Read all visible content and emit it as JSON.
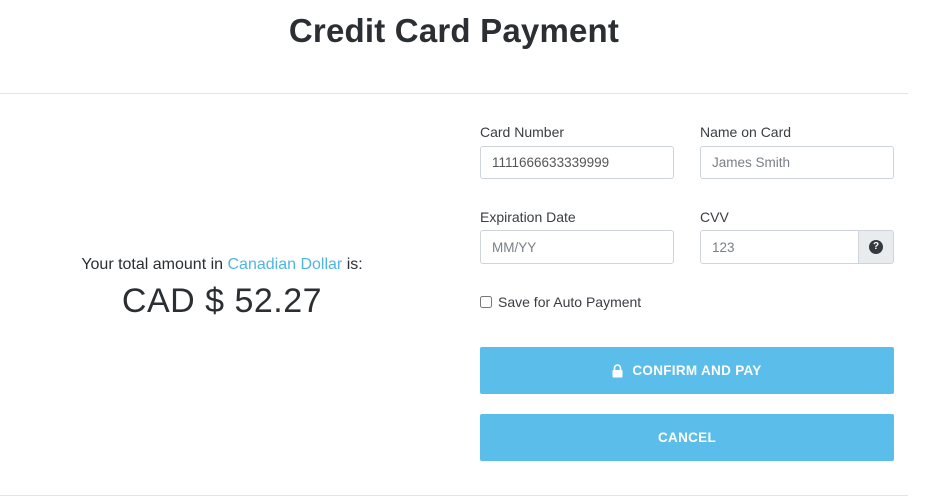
{
  "page": {
    "title": "Credit Card Payment"
  },
  "summary": {
    "label_prefix": "Your total amount in",
    "currency_name": "Canadian Dollar",
    "label_suffix": "is:",
    "amount": "CAD $ 52.27",
    "accent_color": "#4fb6e2"
  },
  "form": {
    "card_number": {
      "label": "Card Number",
      "value": "1111666633339999",
      "placeholder": ""
    },
    "name_on_card": {
      "label": "Name on Card",
      "value": "",
      "placeholder": "James Smith"
    },
    "expiration_date": {
      "label": "Expiration Date",
      "value": "",
      "placeholder": "MM/YY"
    },
    "cvv": {
      "label": "CVV",
      "value": "",
      "placeholder": "123",
      "help_icon": "question-circle-icon"
    },
    "auto_payment": {
      "label": "Save for Auto Payment",
      "checked": false
    }
  },
  "actions": {
    "confirm_label": "CONFIRM AND PAY",
    "confirm_icon": "lock-icon",
    "cancel_label": "CANCEL",
    "button_color": "#5bbde9"
  }
}
